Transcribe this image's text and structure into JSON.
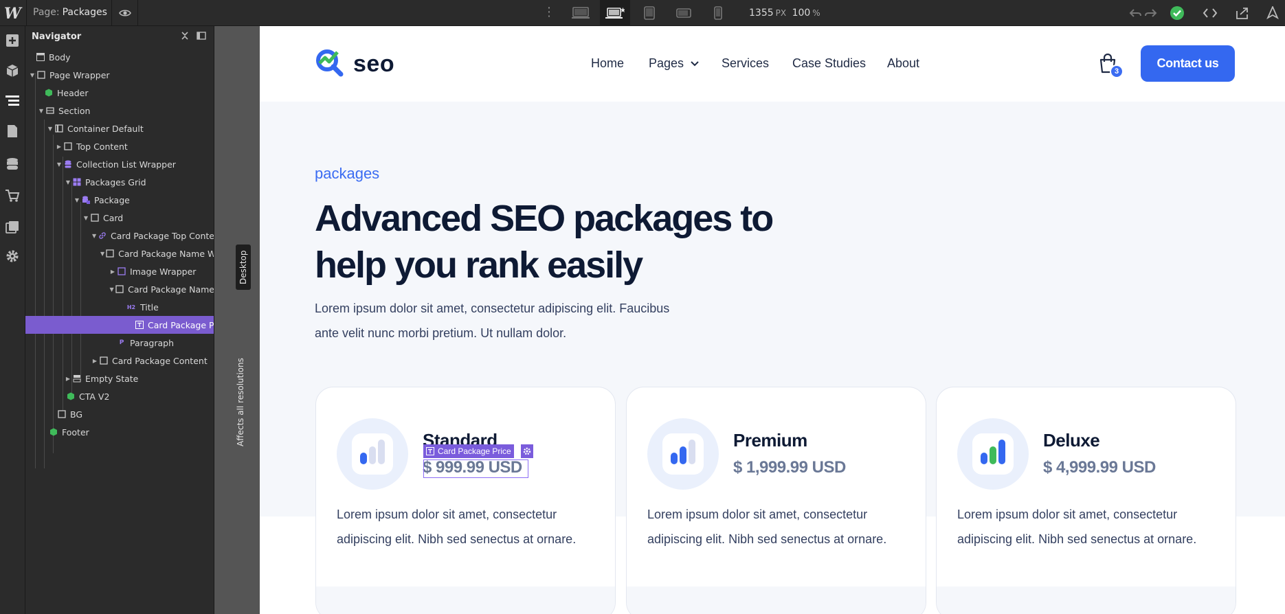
{
  "topbar": {
    "page_label": "Page:",
    "page_name": "Packages",
    "width_value": "1355",
    "width_unit": "PX",
    "zoom_value": "100",
    "zoom_unit": "%"
  },
  "navigator": {
    "title": "Navigator",
    "items": [
      {
        "label": "Body"
      },
      {
        "label": "Page Wrapper"
      },
      {
        "label": "Header"
      },
      {
        "label": "Section"
      },
      {
        "label": "Container Default"
      },
      {
        "label": "Top Content"
      },
      {
        "label": "Collection List Wrapper"
      },
      {
        "label": "Packages Grid"
      },
      {
        "label": "Package"
      },
      {
        "label": "Card"
      },
      {
        "label": "Card Package Top Conte"
      },
      {
        "label": "Card Package Name W"
      },
      {
        "label": "Image Wrapper"
      },
      {
        "label": "Card Package Name"
      },
      {
        "label": "Title"
      },
      {
        "label": "Card Package Pric"
      },
      {
        "label": "Paragraph"
      },
      {
        "label": "Card Package Content"
      },
      {
        "label": "Empty State"
      },
      {
        "label": "CTA V2"
      },
      {
        "label": "BG"
      },
      {
        "label": "Footer"
      }
    ],
    "tag_h2": "H2",
    "tag_p": "P"
  },
  "breakpoint": {
    "affects": "Affects all resolutions",
    "desktop": "Desktop"
  },
  "site": {
    "brand": "seo",
    "menu": [
      "Home",
      "Pages",
      "Services",
      "Case Studies",
      "About"
    ],
    "cart_count": "3",
    "contact_label": "Contact us",
    "eyebrow": "packages",
    "title_line1": "Advanced SEO packages to",
    "title_line2": "help you rank easily",
    "intro_line1": "Lorem ipsum dolor sit amet, consectetur adipiscing elit. Faucibus",
    "intro_line2": "ante velit nunc morbi pretium. Ut nullam dolor.",
    "cards": [
      {
        "name": "Standard",
        "price": "$ 999.99 USD",
        "desc_line1": "Lorem ipsum dolor sit amet, consectetur",
        "desc_line2": "adipiscing elit. Nibh sed senectus at ornare."
      },
      {
        "name": "Premium",
        "price": "$ 1,999.99 USD",
        "desc_line1": "Lorem ipsum dolor sit amet, consectetur",
        "desc_line2": "adipiscing elit. Nibh sed senectus at ornare."
      },
      {
        "name": "Deluxe",
        "price": "$ 4,999.99 USD",
        "desc_line1": "Lorem ipsum dolor sit amet, consectetur",
        "desc_line2": "adipiscing elit. Nibh sed senectus at ornare."
      }
    ]
  },
  "selection": {
    "label": "Card Package Price"
  },
  "colors": {
    "accent": "#3468f0",
    "selection": "#7a5cdc",
    "publish_ok": "#3fba5a"
  }
}
